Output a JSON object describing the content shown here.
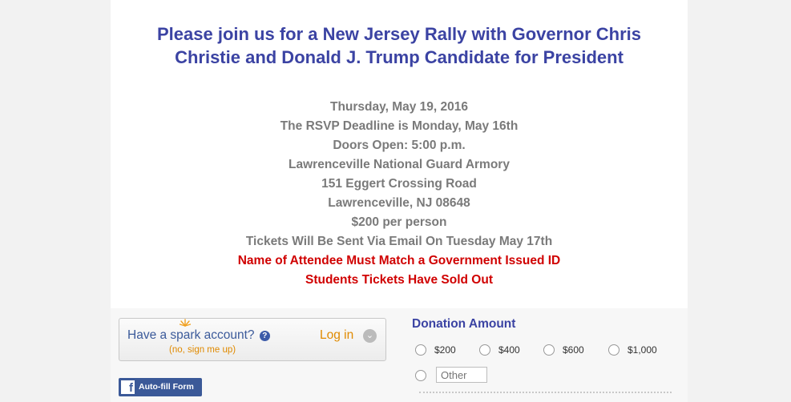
{
  "invitation": {
    "title": "Please join us for a New Jersey Rally with Governor Chris Christie and Donald J. Trump Candidate for President",
    "details": [
      "Thursday, May 19, 2016",
      "The RSVP Deadline is Monday, May 16th",
      "Doors Open: 5:00 p.m.",
      "Lawrenceville National Guard Armory",
      "151 Eggert Crossing Road",
      "Lawrenceville, NJ 08648",
      "$200 per person",
      "Tickets Will Be Sent Via Email On Tuesday May 17th"
    ],
    "notices": [
      "Name of Attendee Must Match a Government Issued ID",
      "Students Tickets Have Sold Out"
    ]
  },
  "spark": {
    "prefix": "Have a ",
    "brand": "spark",
    "suffix": " account?",
    "help_icon": "question-circle-icon",
    "sub_link": "(no, sign me up)",
    "login_label": "Log in"
  },
  "facebook": {
    "icon": "facebook-icon",
    "label": "Auto-fill Form"
  },
  "donation": {
    "title": "Donation Amount",
    "options": [
      "$200",
      "$400",
      "$600",
      "$1,000"
    ],
    "other_placeholder": "Other"
  },
  "colors": {
    "title_blue": "#3b43a3",
    "detail_gray": "#7a7a7a",
    "notice_red": "#d00000",
    "spark_orange": "#e08a00",
    "facebook_blue": "#3b5998"
  }
}
